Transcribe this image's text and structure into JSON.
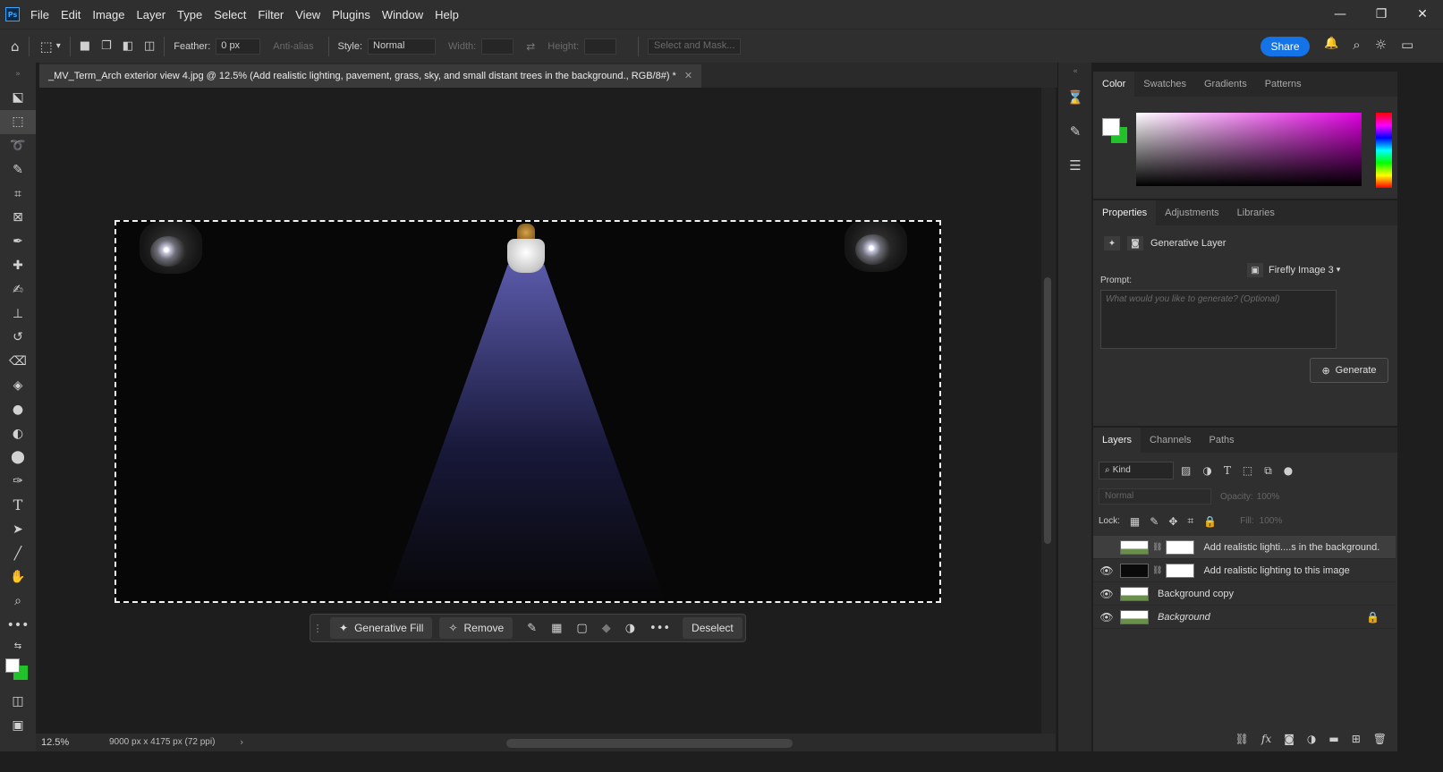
{
  "app": {
    "logo_text": "Ps"
  },
  "menu": [
    "File",
    "Edit",
    "Image",
    "Layer",
    "Type",
    "Select",
    "Filter",
    "View",
    "Plugins",
    "Window",
    "Help"
  ],
  "window_controls": {
    "minimize": "—",
    "restore": "❐",
    "close": "✕"
  },
  "options": {
    "feather_label": "Feather:",
    "feather_value": "0 px",
    "antialias_label": "Anti-alias",
    "style_label": "Style:",
    "style_value": "Normal",
    "width_label": "Width:",
    "height_label": "Height:",
    "select_mask_label": "Select and Mask...",
    "share_label": "Share"
  },
  "document": {
    "tab_title": "_MV_Term_Arch exterior view 4.jpg @ 12.5% (Add realistic lighting, pavement, grass, sky, and small distant trees in the background., RGB/8#) *",
    "close_glyph": "✕"
  },
  "taskbar": {
    "generative_fill": "Generative Fill",
    "remove": "Remove",
    "more": "•••",
    "deselect": "Deselect"
  },
  "status": {
    "zoom": "12.5%",
    "doc_size": "9000 px x 4175 px (72 ppi)",
    "arrow": "›"
  },
  "color_panel": {
    "tabs": [
      "Color",
      "Swatches",
      "Gradients",
      "Patterns"
    ],
    "active": 0
  },
  "properties_panel": {
    "tabs": [
      "Properties",
      "Adjustments",
      "Libraries"
    ],
    "layer_type": "Generative Layer",
    "prompt_label": "Prompt:",
    "model": "Firefly Image 3",
    "prompt_placeholder": "What would you like to generate? (Optional)",
    "generate_label": "Generate"
  },
  "layers_panel": {
    "tabs": [
      "Layers",
      "Channels",
      "Paths"
    ],
    "kind_label": "Kind",
    "blend_mode": "Normal",
    "opacity_label": "Opacity:",
    "opacity_value": "100%",
    "lock_label": "Lock:",
    "fill_label": "Fill:",
    "fill_value": "100%",
    "layers": [
      {
        "name": "Add realistic lighti....s in the background.",
        "visible": false,
        "selected": true,
        "italic": false
      },
      {
        "name": "Add realistic lighting to this image",
        "visible": true,
        "selected": false,
        "italic": false
      },
      {
        "name": "Background copy",
        "visible": true,
        "selected": false,
        "italic": false
      },
      {
        "name": "Background",
        "visible": true,
        "selected": false,
        "italic": true,
        "locked": true
      }
    ]
  },
  "icons": {
    "home": "⌂",
    "marquee": "⬚",
    "bell": "🔔",
    "search": "⌕",
    "bulb": "☼",
    "eye": "👁",
    "lock": "🔒"
  }
}
